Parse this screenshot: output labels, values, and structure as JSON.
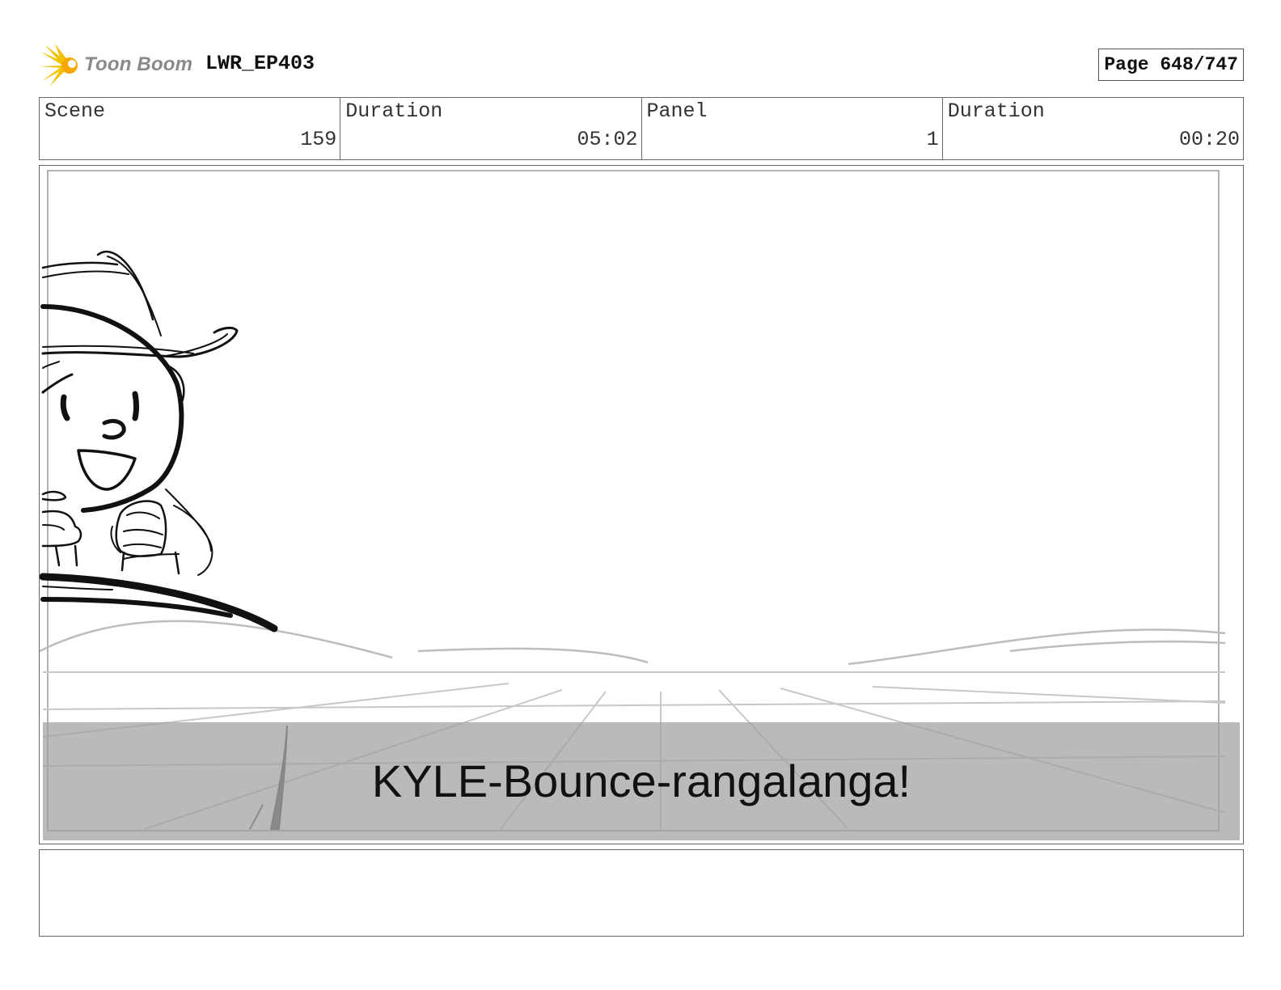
{
  "header": {
    "logo_text": "Toon Boom",
    "project": "LWR_EP403",
    "page": "Page 648/747"
  },
  "info": [
    {
      "label": "Scene",
      "value": "159"
    },
    {
      "label": "Duration",
      "value": "05:02"
    },
    {
      "label": "Panel",
      "value": "1"
    },
    {
      "label": "Duration",
      "value": "00:20"
    }
  ],
  "panel": {
    "subtitle": "KYLE-Bounce-rangalanga!"
  },
  "colors": {
    "logo_accent": "#f2c200",
    "subtitle_band": "#a8a8a8"
  }
}
